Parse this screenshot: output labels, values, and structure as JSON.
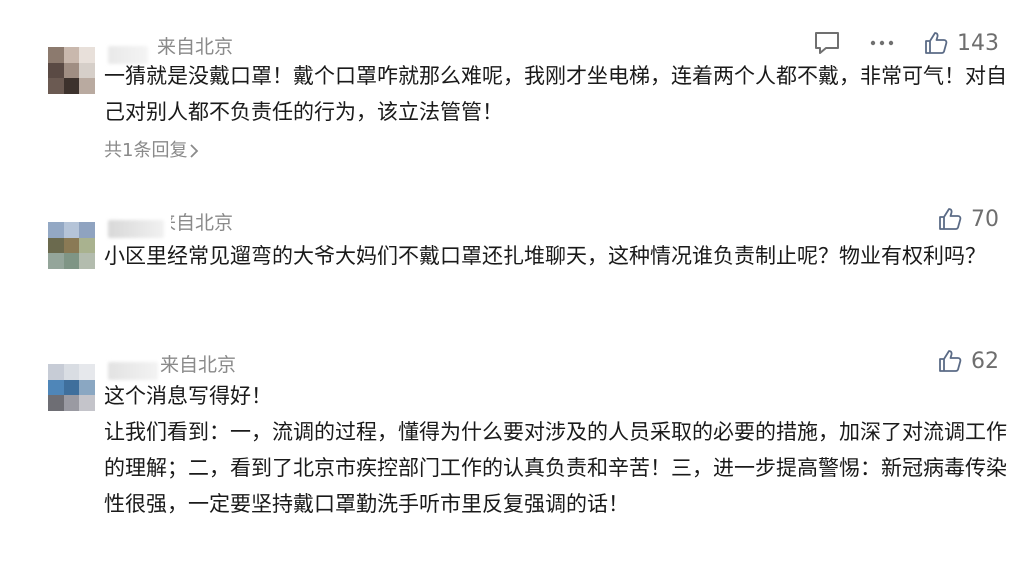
{
  "comments": [
    {
      "source": "来自北京",
      "text": "一猜就是没戴口罩！戴个口罩咋就那么难呢，我刚才坐电梯，连着两个人都不戴，非常可气！对自己对别人都不负责任的行为，该立法管管！",
      "replies_label": "共1条回复",
      "likes": "143",
      "avatar_colors": [
        "#8c7a6e",
        "#c9b8ad",
        "#e8e0da",
        "#5a4a44",
        "#a08e83",
        "#d6cfc9",
        "#6b5a52",
        "#3d322d",
        "#b9aaa0"
      ]
    },
    {
      "source": "来自北京",
      "text": "小区里经常见遛弯的大爷大妈们不戴口罩还扎堆聊天，这种情况谁负责制止呢？物业有权利吗？",
      "likes": "70",
      "avatar_colors": [
        "#93a8c4",
        "#b5c4d8",
        "#8fa3c0",
        "#6b6a4e",
        "#8a7a55",
        "#a9b28f",
        "#94a59a",
        "#7f9585",
        "#b3bcae"
      ]
    },
    {
      "source": "来自北京",
      "text_lines": [
        "这个消息写得好！",
        "让我们看到：一，流调的过程，懂得为什么要对涉及的人员采取的必要的措施，加深了对流调工作的理解；二，看到了北京市疾控部门工作的认真负责和辛苦！三，进一步提高警惕：新冠病毒传染性很强，一定要坚持戴口罩勤洗手听市里反复强调的话！"
      ],
      "likes": "62",
      "avatar_colors": [
        "#c7ccd6",
        "#d9dde3",
        "#e6e8ec",
        "#4f86b8",
        "#3f6f9c",
        "#8aa7c2",
        "#6e6e74",
        "#9a9aa2",
        "#c4c4ca"
      ]
    }
  ],
  "icons": {
    "comment": "comment-icon",
    "more": "more-icon",
    "like": "thumbs-up-icon",
    "chevron": "chevron-right-icon"
  }
}
